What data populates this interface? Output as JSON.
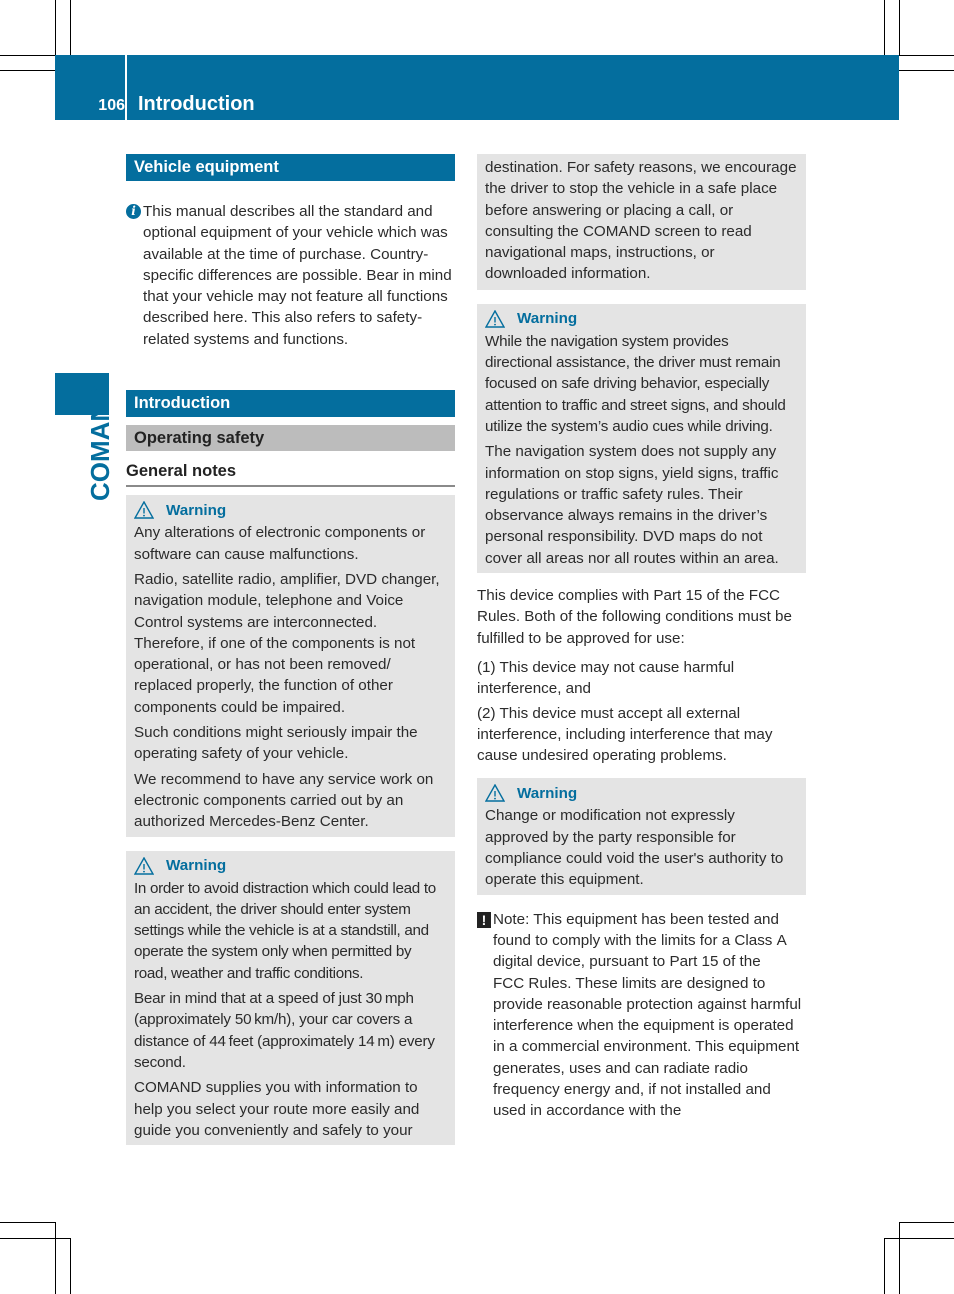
{
  "header": {
    "page_number": "106",
    "title": "Introduction"
  },
  "sidebar": {
    "chapter_label": "COMAND"
  },
  "left_column": {
    "vehicle_equipment": {
      "heading": "Vehicle equipment",
      "info_icon": "info-icon",
      "info_text": "This manual describes all the standard and optional equipment of your vehicle which was available at the time of purchase. Country-specific differences are possible. Bear in mind that your vehicle may not feature all functions described here. This also refers to safety-related systems and functions."
    },
    "introduction_heading": "Introduction",
    "operating_safety_heading": "Operating safety",
    "general_notes_heading": "General notes",
    "warning1": {
      "icon": "warning-triangle-icon",
      "label": "Warning",
      "paragraphs": [
        "Any alterations of electronic components or software can cause malfunctions.",
        "Radio, satellite radio, amplifier, DVD changer, navigation module, telephone and Voice Control systems are interconnected. Therefore, if one of the components is not operational, or has not been removed/ replaced properly, the function of other components could be impaired.",
        "Such conditions might seriously impair the operating safety of your vehicle.",
        "We recommend to have any service work on electronic components carried out by an authorized Mercedes-Benz Center."
      ]
    },
    "warning2": {
      "icon": "warning-triangle-icon",
      "label": "Warning",
      "paragraphs": [
        "In order to avoid distraction which could lead to an accident, the driver should enter system settings while the vehicle is at a standstill, and operate the system only when permitted by road, weather and traffic conditions.",
        "Bear in mind that at a speed of just 30 mph (approximately 50 km/h), your car covers a distance of 44 feet (approximately 14 m) every second.",
        "COMAND supplies you with information to help you select your route more easily and guide you conveniently and safely to your"
      ]
    }
  },
  "right_column": {
    "warning2_continued": "destination. For safety reasons, we encourage the driver to stop the vehicle in a safe place before answering or placing a call, or consulting the COMAND screen to read navigational maps, instructions, or downloaded information.",
    "warning3": {
      "icon": "warning-triangle-icon",
      "label": "Warning",
      "paragraphs": [
        "While the navigation system provides directional assistance, the driver must remain focused on safe driving behavior, especially attention to traffic and street signs, and should utilize the system’s audio cues while driving.",
        "The navigation system does not supply any information on stop signs, yield signs, traffic regulations or traffic safety rules. Their observance always remains in the driver’s personal responsibility. DVD maps do not cover all areas nor all routes within an area."
      ]
    },
    "fcc_paragraphs": [
      "This device complies with Part 15 of the FCC Rules. Both of the following conditions must be fulfilled to be approved for use:",
      "(1) This device may not cause harmful interference, and",
      "(2) This device must accept all external interference, including interference that may cause undesired operating problems."
    ],
    "warning4": {
      "icon": "warning-triangle-icon",
      "label": "Warning",
      "paragraphs": [
        "Change or modification not expressly approved by the party responsible for compliance could void the user's authority to operate this equipment."
      ]
    },
    "note": {
      "icon": "exclamation-icon",
      "text": "Note: This equipment has been tested and found to comply with the limits for a Class A digital device, pursuant to Part 15 of the FCC Rules. These limits are designed to provide reasonable protection against harmful interference when the equipment is operated in a commercial environment. This equipment generates, uses and can radiate radio frequency energy and, if not installed and used in accordance with the"
    }
  },
  "colors": {
    "brand_blue": "#046e9e",
    "subheading_grey": "#bcbcbc",
    "warning_box_bg": "#e4e4e4"
  }
}
